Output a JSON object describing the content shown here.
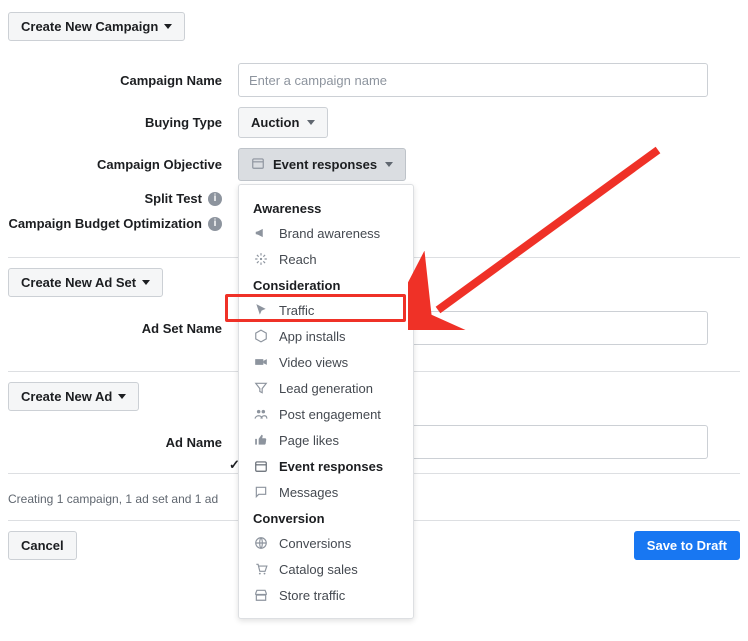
{
  "buttons": {
    "create_campaign": "Create New Campaign",
    "create_ad_set": "Create New Ad Set",
    "create_ad": "Create New Ad",
    "cancel": "Cancel",
    "save_draft": "Save to Draft"
  },
  "labels": {
    "campaign_name": "Campaign Name",
    "buying_type": "Buying Type",
    "campaign_objective": "Campaign Objective",
    "split_test": "Split Test",
    "budget_optimization": "Campaign Budget Optimization",
    "ad_set_name": "Ad Set Name",
    "ad_name": "Ad Name"
  },
  "placeholders": {
    "campaign_name": "Enter a campaign name"
  },
  "values": {
    "buying_type": "Auction",
    "campaign_objective": "Event responses"
  },
  "status": "Creating 1 campaign, 1 ad set and 1 ad",
  "objective_menu": {
    "groups": [
      {
        "title": "Awareness",
        "items": [
          {
            "icon": "megaphone-icon",
            "label": "Brand awareness"
          },
          {
            "icon": "reach-icon",
            "label": "Reach"
          }
        ]
      },
      {
        "title": "Consideration",
        "items": [
          {
            "icon": "cursor-icon",
            "label": "Traffic"
          },
          {
            "icon": "package-icon",
            "label": "App installs"
          },
          {
            "icon": "video-icon",
            "label": "Video views"
          },
          {
            "icon": "funnel-icon",
            "label": "Lead generation"
          },
          {
            "icon": "people-icon",
            "label": "Post engagement"
          },
          {
            "icon": "thumbs-up-icon",
            "label": "Page likes"
          },
          {
            "icon": "calendar-icon",
            "label": "Event responses",
            "selected": true
          },
          {
            "icon": "chat-icon",
            "label": "Messages"
          }
        ]
      },
      {
        "title": "Conversion",
        "items": [
          {
            "icon": "globe-icon",
            "label": "Conversions"
          },
          {
            "icon": "cart-icon",
            "label": "Catalog sales"
          },
          {
            "icon": "store-icon",
            "label": "Store traffic"
          }
        ]
      }
    ]
  }
}
